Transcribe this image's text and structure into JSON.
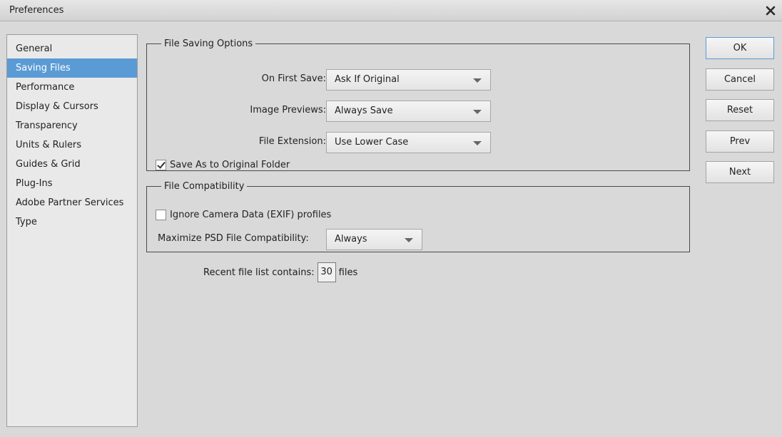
{
  "window": {
    "title": "Preferences",
    "close_icon": "close-icon"
  },
  "sidebar": {
    "items": [
      {
        "label": "General"
      },
      {
        "label": "Saving Files"
      },
      {
        "label": "Performance"
      },
      {
        "label": "Display & Cursors"
      },
      {
        "label": "Transparency"
      },
      {
        "label": "Units & Rulers"
      },
      {
        "label": "Guides & Grid"
      },
      {
        "label": "Plug-Ins"
      },
      {
        "label": "Adobe Partner Services"
      },
      {
        "label": "Type"
      }
    ],
    "selected": "Saving Files",
    "selected_color": "#5b9bd5"
  },
  "file_saving_options": {
    "legend": "File Saving Options",
    "on_first_save": {
      "label": "On First Save:",
      "value": "Ask If Original"
    },
    "image_previews": {
      "label": "Image Previews:",
      "value": "Always Save"
    },
    "file_extension": {
      "label": "File Extension:",
      "value": "Use Lower Case"
    },
    "save_as_original": {
      "label": "Save As to Original Folder",
      "checked": true
    }
  },
  "file_compatibility": {
    "legend": "File Compatibility",
    "ignore_exif": {
      "label": "Ignore Camera Data (EXIF) profiles",
      "checked": false
    },
    "maximize_psd": {
      "label": "Maximize PSD File Compatibility:",
      "value": "Always"
    }
  },
  "recent_files": {
    "label": "Recent file list contains:",
    "value": "30",
    "suffix": "files"
  },
  "buttons": {
    "ok": "OK",
    "cancel": "Cancel",
    "reset": "Reset",
    "prev": "Prev",
    "next": "Next"
  }
}
